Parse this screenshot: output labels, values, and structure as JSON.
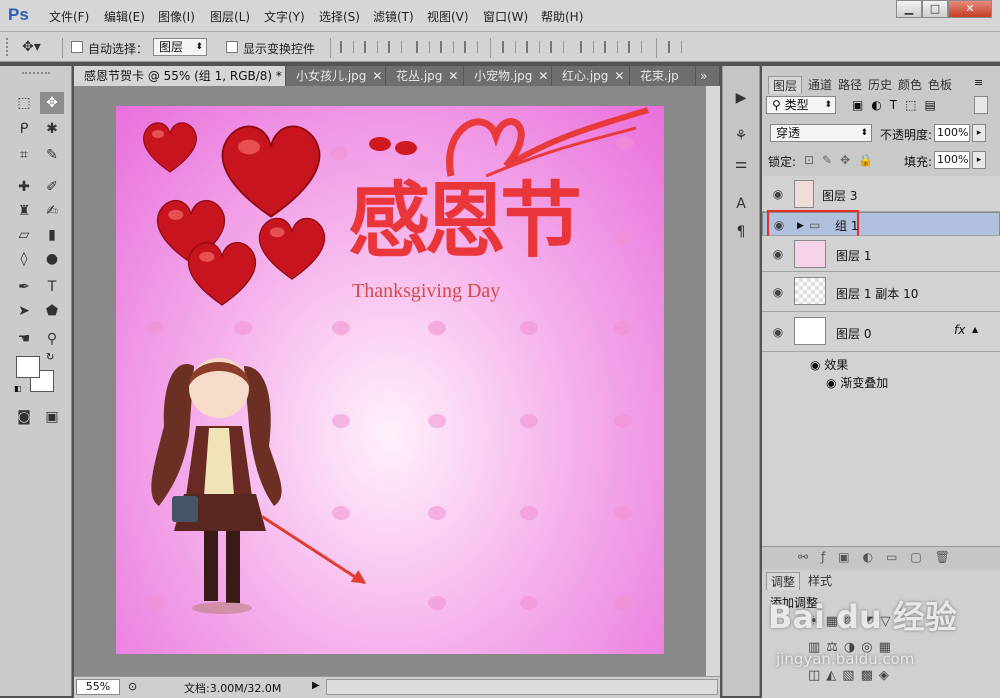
{
  "app": {
    "logo": "Ps"
  },
  "menu": [
    "文件(F)",
    "编辑(E)",
    "图像(I)",
    "图层(L)",
    "文字(Y)",
    "选择(S)",
    "滤镜(T)",
    "视图(V)",
    "窗口(W)",
    "帮助(H)"
  ],
  "window_controls": {
    "minimize": "▁",
    "maximize": "□",
    "close": "✕"
  },
  "options_bar": {
    "auto_select_label": "自动选择：",
    "auto_select_value": "图层",
    "show_transform_label": "显示变换控件"
  },
  "tabs": [
    {
      "label": "感恩节贺卡 @ 55% (组 1, RGB/8) *",
      "active": true
    },
    {
      "label": "小女孩儿.jpg",
      "active": false
    },
    {
      "label": "花丛.jpg",
      "active": false
    },
    {
      "label": "小宠物.jpg",
      "active": false
    },
    {
      "label": "红心.jpg",
      "active": false
    },
    {
      "label": "花束.jp",
      "active": false
    }
  ],
  "tab_overflow": "»",
  "canvas": {
    "title_cn": "感恩节",
    "subtitle_en": "Thanksgiving Day"
  },
  "status": {
    "zoom": "55%",
    "doc_info": "文档:3.00M/32.0M"
  },
  "panel": {
    "tabs": [
      "图层",
      "通道",
      "路径",
      "历史",
      "颜色",
      "色板"
    ],
    "filter_kind": "类型",
    "blend_mode": "穿透",
    "opacity_label": "不透明度:",
    "opacity_value": "100%",
    "lock_label": "锁定:",
    "fill_label": "填充:",
    "fill_value": "100%",
    "layers": [
      {
        "name": "图层 3",
        "type": "layer",
        "selected": false
      },
      {
        "name": "组 1",
        "type": "group",
        "selected": true
      },
      {
        "name": "图层 1",
        "type": "layer",
        "selected": false
      },
      {
        "name": "图层 1 副本 10",
        "type": "layer",
        "selected": false
      },
      {
        "name": "图层 0",
        "type": "layer",
        "selected": false,
        "fx": "fx"
      }
    ],
    "effects_label": "效果",
    "effect_item": "渐变叠加",
    "adjust_tabs": [
      "调整",
      "样式"
    ],
    "adjust_title": "添加调整"
  },
  "watermark": {
    "line1": "Bai du 经验",
    "line2": "jingyan.baidu.com"
  },
  "colors": {
    "accent_red": "#e0302a",
    "selection_blue": "#b1c0dc",
    "canvas_pink": "#f5b4ec"
  }
}
